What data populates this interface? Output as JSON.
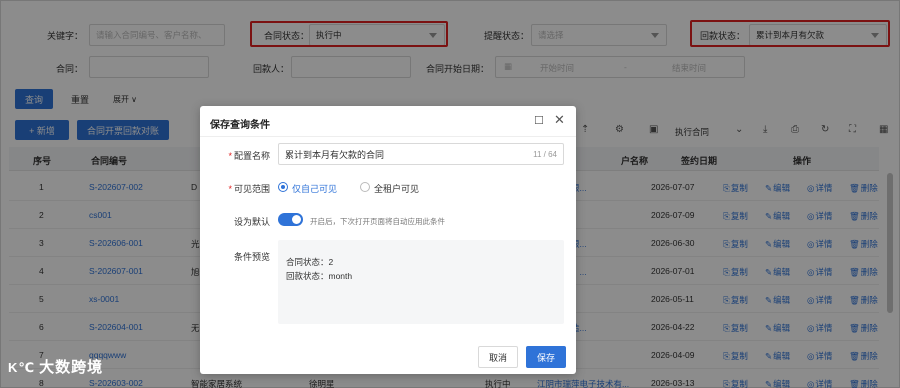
{
  "filters": {
    "keyword_label": "关键字：",
    "keyword_placeholder": "请输入合同编号、客户名称、",
    "contract_status_label": "合同状态：",
    "contract_status_value": "执行中",
    "reminder_label": "提醒状态：",
    "reminder_placeholder": "请选择",
    "payment_status_label": "回款状态：",
    "payment_status_value": "累计到本月有欠款",
    "contract_label": "合同：",
    "payer_label": "回款人：",
    "start_date_label": "合同开始日期：",
    "start_placeholder": "开始时间",
    "range_sep": "-",
    "end_placeholder": "结束时间"
  },
  "actions": {
    "query": "查询",
    "reset": "重置",
    "expand": "展开 ∨",
    "add": "+ 新增",
    "invoice_check": "合同开票回款对账",
    "exec_contract": "执行合同"
  },
  "table": {
    "headers": [
      "序号",
      "合同编号",
      "户名称",
      "签约日期",
      "操作"
    ],
    "rows": [
      {
        "idx": "1",
        "code": "S-202607-002",
        "c3": "D",
        "customer": "速技术有限...",
        "date": "2026-07-07"
      },
      {
        "idx": "2",
        "code": "cs001",
        "c3": "",
        "customer": "客户-华",
        "date": "2026-07-09"
      },
      {
        "idx": "3",
        "code": "S-202606-001",
        "c3": "光明眼科",
        "customer": "科医院有限...",
        "date": "2026-06-30"
      },
      {
        "idx": "4",
        "code": "S-202607-001",
        "c3": "旭佳 1",
        "customer": "技（无锡）...",
        "date": "2026-07-01"
      },
      {
        "idx": "5",
        "code": "xs-0001",
        "c3": "",
        "customer": "测试客户",
        "date": "2026-05-11"
      },
      {
        "idx": "6",
        "code": "S-202604-001",
        "c3": "无锡",
        "customer": "莫科技制造...",
        "date": "2026-04-22"
      },
      {
        "idx": "7",
        "code": "qqqqwww",
        "c3": "",
        "customer": "测试客户",
        "date": "2026-04-09"
      },
      {
        "idx": "8",
        "code": "S-202603-002",
        "c3": "智能家居系统",
        "customer": "江阴市瑞萍电子技术有...",
        "date": "2026-03-13"
      }
    ],
    "row8_extra": {
      "name": "徐明星",
      "status": "执行中"
    },
    "ops": [
      "复制",
      "编辑",
      "详情",
      "删除"
    ]
  },
  "modal": {
    "title": "保存查询条件",
    "name_label": "配置名称",
    "name_value": "累计到本月有欠款的合同",
    "name_counter": "11 / 64",
    "scope_label": "可见范围",
    "scope_self": "仅自己可见",
    "scope_all": "全租户可见",
    "default_label": "设为默认",
    "default_hint": "开启后，下次打开页面将自动应用此条件",
    "preview_label": "条件预览",
    "preview_line1": "合同状态：2",
    "preview_line2": "回款状态：month",
    "cancel": "取消",
    "save": "保存"
  },
  "watermark": "大数跨境",
  "watermark_logo": "K℃"
}
